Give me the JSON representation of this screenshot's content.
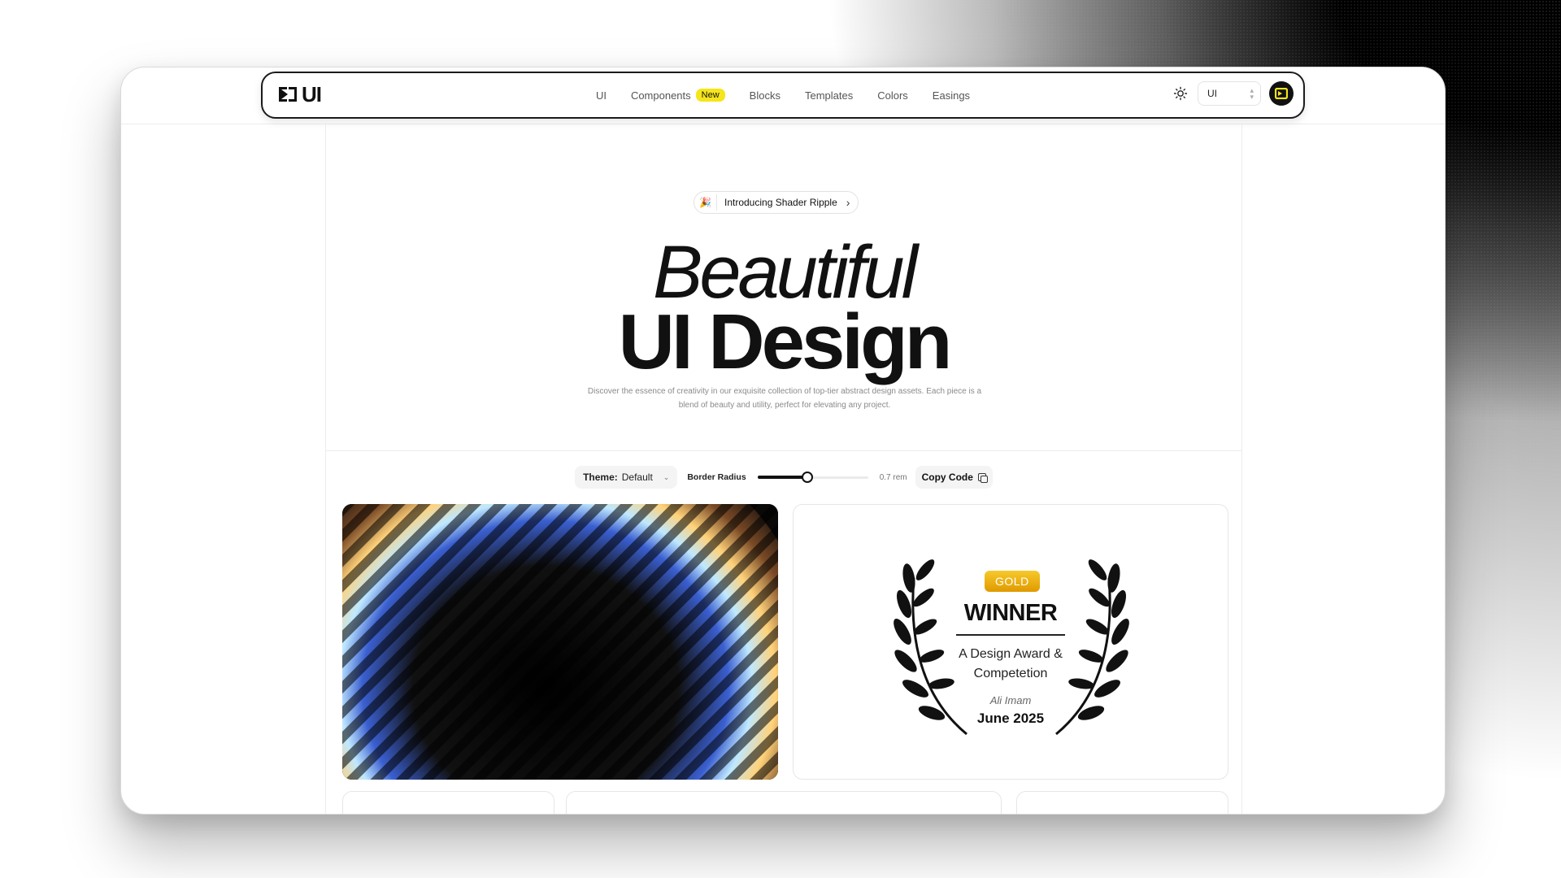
{
  "brand": {
    "logo_text": "UI"
  },
  "nav": {
    "items": [
      {
        "label": "UI"
      },
      {
        "label": "Components",
        "badge": "New"
      },
      {
        "label": "Blocks"
      },
      {
        "label": "Templates"
      },
      {
        "label": "Colors"
      },
      {
        "label": "Easings"
      }
    ],
    "select_value": "UI",
    "accent_color": "#f5e51b"
  },
  "hero": {
    "pill_emoji": "🎉",
    "pill_text": "Introducing Shader Ripple",
    "title_line1": "Beautiful",
    "title_line2": "UI Design",
    "description": "Discover the essence of creativity in our exquisite collection of top-tier abstract design assets. Each piece is a blend of beauty and utility, perfect for elevating any project."
  },
  "controls": {
    "theme_label": "Theme:",
    "theme_value": "Default",
    "radius_label": "Border Radius",
    "radius_value": "0.7 rem",
    "radius_fraction": 0.45,
    "copy_label": "Copy Code"
  },
  "award": {
    "badge": "GOLD",
    "title": "WINNER",
    "subtitle_line1": "A Design Award &",
    "subtitle_line2": "Competetion",
    "author": "Ali Imam",
    "date": "June 2025"
  }
}
